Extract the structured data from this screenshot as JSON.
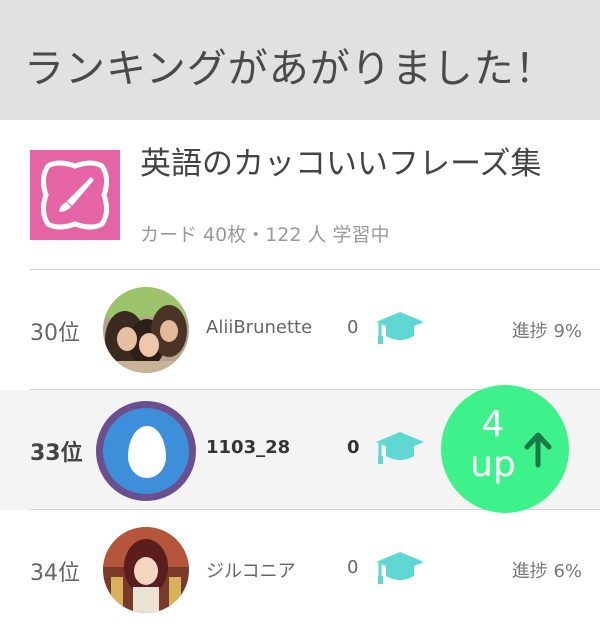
{
  "header": {
    "title": "ランキングがあがりました！"
  },
  "deck": {
    "icon": "paintbrush-frame-icon",
    "title": "英語のカッコいいフレーズ集",
    "meta": "カード 40枚・122 人 学習中"
  },
  "ranking": [
    {
      "rank": "30位",
      "username": "AliiBrunette",
      "score": "0",
      "progress": "進捗 9%",
      "avatar": "photo-avatar"
    },
    {
      "rank": "33位",
      "username": "1103_28",
      "score": "0",
      "progress": "",
      "avatar": "egg-avatar"
    },
    {
      "rank": "34位",
      "username": "ジルコニア",
      "score": "0",
      "progress": "進捗 6%",
      "avatar": "anime-avatar"
    }
  ],
  "badge": {
    "count": "4",
    "label": "up",
    "icon": "arrow-up-icon"
  },
  "colors": {
    "header_bg": "#e1e1e1",
    "deck_icon": "#e564a5",
    "cap": "#5fd8d2",
    "badge": "#3ef28b",
    "arrow": "#1a7a45",
    "egg_bg": "#3d8fd9",
    "egg_ring": "#6c4f8e"
  }
}
